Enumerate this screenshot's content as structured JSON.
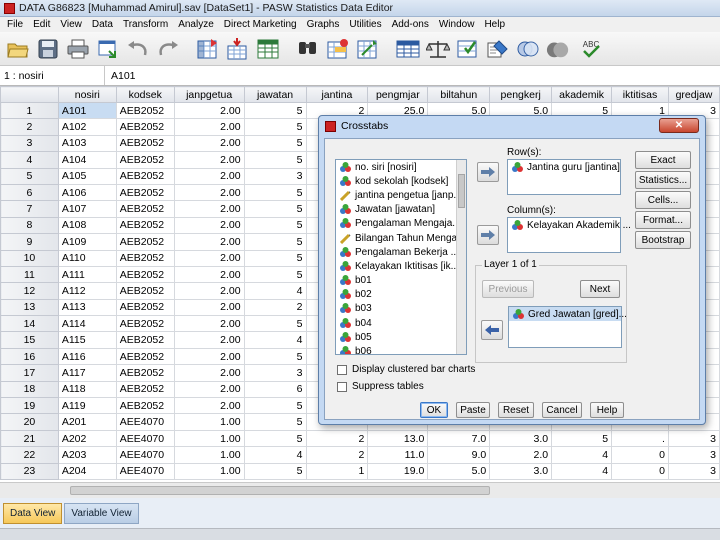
{
  "window": {
    "title": "DATA G86823 [Muhammad Amirul].sav [DataSet1] - PASW Statistics Data Editor"
  },
  "menu": [
    "File",
    "Edit",
    "View",
    "Data",
    "Transform",
    "Analyze",
    "Direct Marketing",
    "Graphs",
    "Utilities",
    "Add-ons",
    "Window",
    "Help"
  ],
  "toolbar": {
    "icons": [
      "open-icon",
      "save-icon",
      "print-icon",
      "dialog-recall-icon",
      "undo-icon",
      "redo-icon",
      "goto-case-icon",
      "goto-variable-icon",
      "variables-icon",
      "find-icon",
      "insert-cases-icon",
      "insert-variable-icon",
      "split-file-icon",
      "weight-cases-icon",
      "select-cases-icon",
      "value-labels-icon",
      "use-sets-icon",
      "spell-check-icon"
    ],
    "spell_label": "ABC"
  },
  "cell_editor": {
    "ref": "1 : nosiri",
    "value": "A101"
  },
  "grid": {
    "columns": [
      "nosiri",
      "kodsek",
      "janpgetua",
      "jawatan",
      "jantina",
      "pengmjar",
      "biltahun",
      "pengkerj",
      "akademik",
      "iktitisas",
      "gredjaw"
    ],
    "rows": [
      [
        "1",
        "A101",
        "AEB2052",
        "2.00",
        "5",
        "2",
        "25.0",
        "5.0",
        "5.0",
        "5",
        "1",
        "3"
      ],
      [
        "2",
        "A102",
        "AEB2052",
        "2.00",
        "5",
        "",
        "",
        "",
        "",
        "",
        "",
        ""
      ],
      [
        "3",
        "A103",
        "AEB2052",
        "2.00",
        "5",
        "",
        "",
        "",
        "",
        "",
        "",
        ""
      ],
      [
        "4",
        "A104",
        "AEB2052",
        "2.00",
        "5",
        "",
        "",
        "",
        "",
        "",
        "",
        ""
      ],
      [
        "5",
        "A105",
        "AEB2052",
        "2.00",
        "3",
        "",
        "",
        "",
        "",
        "",
        "",
        ""
      ],
      [
        "6",
        "A106",
        "AEB2052",
        "2.00",
        "5",
        "",
        "",
        "",
        "",
        "",
        "",
        ""
      ],
      [
        "7",
        "A107",
        "AEB2052",
        "2.00",
        "5",
        "",
        "",
        "",
        "",
        "",
        "",
        ""
      ],
      [
        "8",
        "A108",
        "AEB2052",
        "2.00",
        "5",
        "",
        "",
        "",
        "",
        "",
        "",
        ""
      ],
      [
        "9",
        "A109",
        "AEB2052",
        "2.00",
        "5",
        "",
        "",
        "",
        "",
        "",
        "",
        ""
      ],
      [
        "10",
        "A110",
        "AEB2052",
        "2.00",
        "5",
        "",
        "",
        "",
        "",
        "",
        "",
        ""
      ],
      [
        "11",
        "A111",
        "AEB2052",
        "2.00",
        "5",
        "",
        "",
        "",
        "",
        "",
        "",
        ""
      ],
      [
        "12",
        "A112",
        "AEB2052",
        "2.00",
        "4",
        "",
        "",
        "",
        "",
        "",
        "",
        ""
      ],
      [
        "13",
        "A113",
        "AEB2052",
        "2.00",
        "2",
        "",
        "",
        "",
        "",
        "",
        "",
        ""
      ],
      [
        "14",
        "A114",
        "AEB2052",
        "2.00",
        "5",
        "",
        "",
        "",
        "",
        "",
        "",
        ""
      ],
      [
        "15",
        "A115",
        "AEB2052",
        "2.00",
        "4",
        "",
        "",
        "",
        "",
        "",
        "",
        ""
      ],
      [
        "16",
        "A116",
        "AEB2052",
        "2.00",
        "5",
        "",
        "",
        "",
        "",
        "",
        "",
        ""
      ],
      [
        "17",
        "A117",
        "AEB2052",
        "2.00",
        "3",
        "",
        "",
        "",
        "",
        "",
        "",
        ""
      ],
      [
        "18",
        "A118",
        "AEB2052",
        "2.00",
        "6",
        "",
        "",
        "",
        "",
        "",
        "",
        ""
      ],
      [
        "19",
        "A119",
        "AEB2052",
        "2.00",
        "5",
        "",
        "",
        "",
        "",
        "",
        "",
        ""
      ],
      [
        "20",
        "A201",
        "AEE4070",
        "1.00",
        "5",
        "",
        "",
        "",
        "",
        "",
        "",
        ""
      ],
      [
        "21",
        "A202",
        "AEE4070",
        "1.00",
        "5",
        "2",
        "13.0",
        "7.0",
        "3.0",
        "5",
        ".",
        "3"
      ],
      [
        "22",
        "A203",
        "AEE4070",
        "1.00",
        "4",
        "2",
        "11.0",
        "9.0",
        "2.0",
        "4",
        "0",
        "3"
      ],
      [
        "23",
        "A204",
        "AEE4070",
        "1.00",
        "5",
        "1",
        "19.0",
        "5.0",
        "3.0",
        "4",
        "0",
        "3"
      ]
    ]
  },
  "tabs": [
    "Data View",
    "Variable View"
  ],
  "dialog": {
    "title": "Crosstabs",
    "variables": [
      {
        "label": "no. siri [nosiri]",
        "icon": "nominal-icon"
      },
      {
        "label": "kod sekolah [kodsek]",
        "icon": "nominal-icon"
      },
      {
        "label": "jantina pengetua [janp...",
        "icon": "scale-icon"
      },
      {
        "label": "Jawatan [jawatan]",
        "icon": "nominal-icon"
      },
      {
        "label": "Pengalaman Mengaja...",
        "icon": "nominal-icon"
      },
      {
        "label": "Bilangan Tahun Mengaj...",
        "icon": "scale-icon"
      },
      {
        "label": "Pengalaman Bekerja ...",
        "icon": "nominal-icon"
      },
      {
        "label": "Kelayakan Iktitisas [ik...",
        "icon": "nominal-icon"
      },
      {
        "label": "b01",
        "icon": "nominal-icon"
      },
      {
        "label": "b02",
        "icon": "nominal-icon"
      },
      {
        "label": "b03",
        "icon": "nominal-icon"
      },
      {
        "label": "b04",
        "icon": "nominal-icon"
      },
      {
        "label": "b05",
        "icon": "nominal-icon"
      },
      {
        "label": "b06",
        "icon": "nominal-icon"
      }
    ],
    "rows_label": "Row(s):",
    "row_var": "Jantina guru [jantina]",
    "columns_label": "Column(s):",
    "col_var": "Kelayakan Akademik ...",
    "layer_label": "Layer 1 of 1",
    "previous_label": "Previous",
    "next_label": "Next",
    "layer_var": "Gred Jawatan [gred]...",
    "side_buttons": [
      "Exact",
      "Statistics...",
      "Cells...",
      "Format...",
      "Bootstrap"
    ],
    "checkbox_clustered": "Display clustered bar charts",
    "checkbox_suppress": "Suppress tables",
    "ok_label": "OK",
    "paste_label": "Paste",
    "reset_label": "Reset",
    "cancel_label": "Cancel",
    "help_label": "Help"
  }
}
